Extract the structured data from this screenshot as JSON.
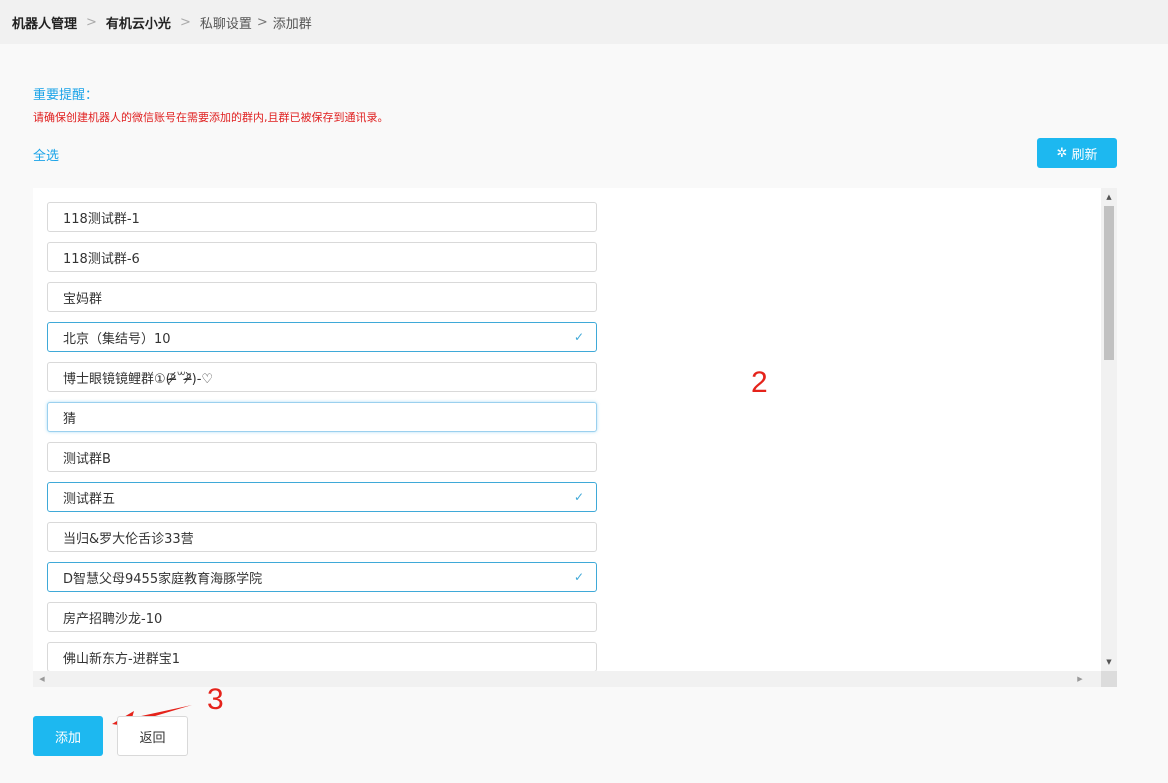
{
  "breadcrumb": {
    "items": [
      "机器人管理",
      "有机云小光",
      "私聊设置",
      "添加群"
    ],
    "separators": [
      ">",
      ">",
      ">"
    ]
  },
  "notice": {
    "title": "重要提醒：",
    "text": "请确保创建机器人的微信账号在需要添加的群内,且群已被保存到通讯录。"
  },
  "actions": {
    "select_all": "全选",
    "refresh_label": "刷新",
    "refresh_icon": "✲",
    "add_label": "添加",
    "back_label": "返回"
  },
  "groups": [
    {
      "name": "118测试群-1",
      "selected": false
    },
    {
      "name": "118测试群-6",
      "selected": false
    },
    {
      "name": "宝妈群",
      "selected": false
    },
    {
      "name": "北京（集结号）10",
      "selected": true
    },
    {
      "name": "博士眼镜镜鲤群①(ᵒ̴̶̷᷄꒳ᵒ̴̶̷᷅)-♡",
      "selected": false
    },
    {
      "name": "猜",
      "selected": false,
      "focused": true
    },
    {
      "name": "测试群B",
      "selected": false
    },
    {
      "name": "测试群五",
      "selected": true
    },
    {
      "name": "当归&罗大伦舌诊33营",
      "selected": false
    },
    {
      "name": "D智慧父母9455家庭教育海豚学院",
      "selected": true
    },
    {
      "name": "房产招聘沙龙-10",
      "selected": false
    },
    {
      "name": "佛山新东方-进群宝1",
      "selected": false
    }
  ],
  "annotations": {
    "label_2": "2",
    "label_3": "3",
    "color": "#e5231b"
  },
  "colors": {
    "accent": "#1db8f0",
    "link": "#1aa3e8",
    "warning": "#e02020",
    "selected_border": "#3fa9d8"
  }
}
